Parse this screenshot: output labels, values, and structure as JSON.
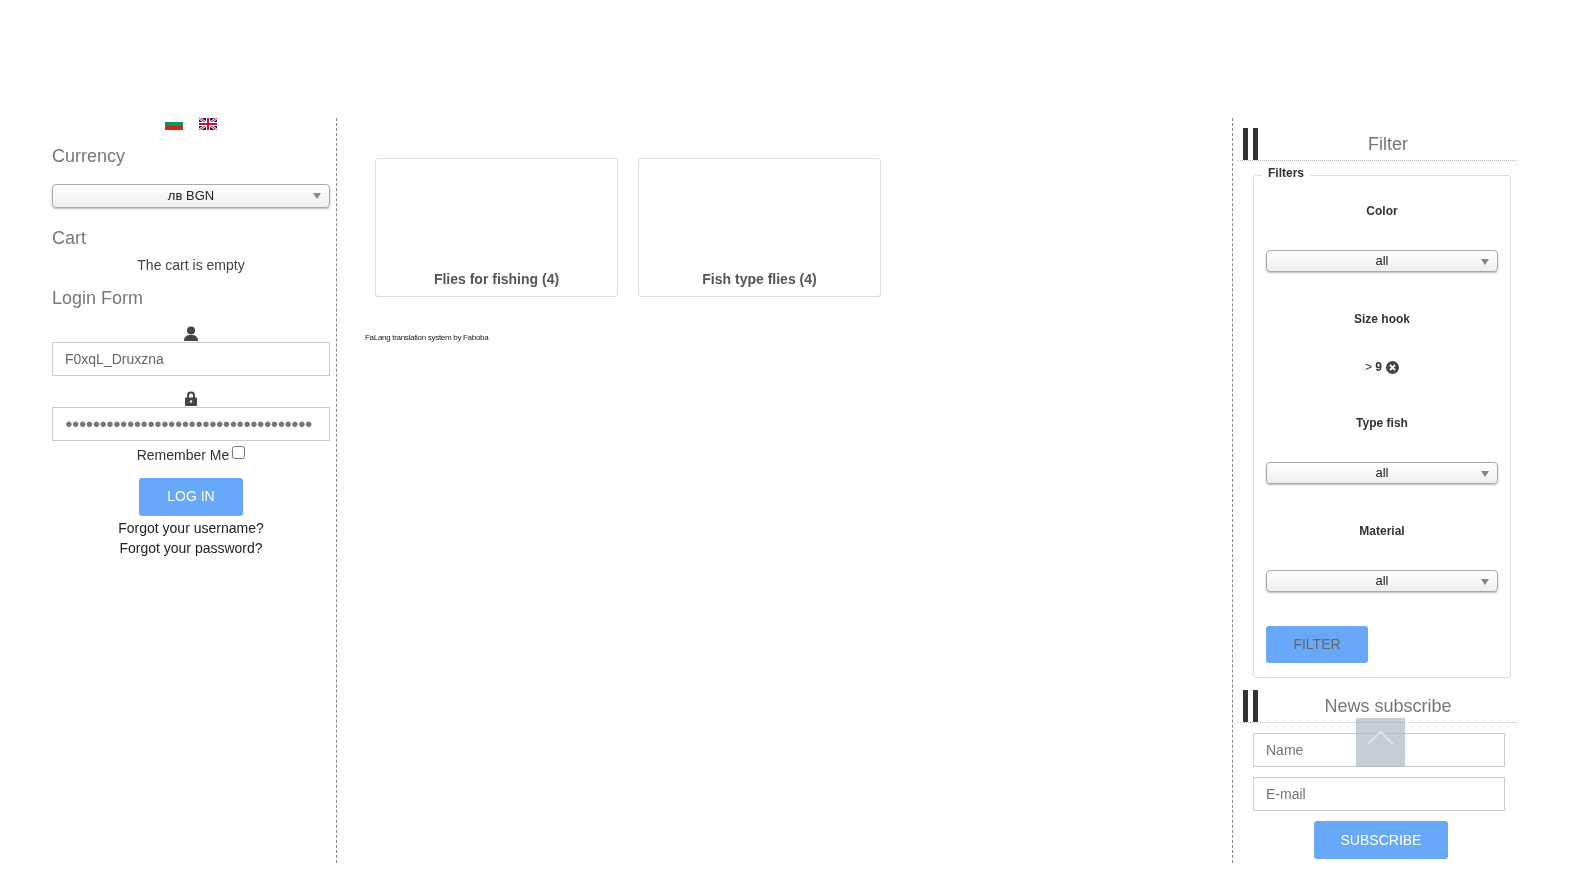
{
  "languages": [
    {
      "kind": "bg"
    },
    {
      "kind": "en"
    }
  ],
  "currency": {
    "title": "Currency",
    "value": "лв BGN"
  },
  "cart": {
    "title": "Cart",
    "message": "The cart is empty"
  },
  "login": {
    "title": "Login Form",
    "username": "F0xqL_Druxzna",
    "password": "●●●●●●●●●●●●●●●●●●●●●●●●●●●●●●●●●●●●",
    "remember_label": "Remember Me",
    "remember_checked": false,
    "button": "LOG IN",
    "links": [
      "Forgot your username?",
      "Forgot your password?"
    ]
  },
  "categories": [
    {
      "title": "Flies for fishing (4)"
    },
    {
      "title": "Fish type flies (4)"
    }
  ],
  "footer_credit": "FaLang translation system by Faboba",
  "filter": {
    "title": "Filter",
    "legend": "Filters",
    "fields": [
      {
        "kind": "select",
        "label": "Color",
        "value": "all"
      },
      {
        "kind": "chip",
        "label": "Size hook",
        "value": "> **9**"
      },
      {
        "kind": "select",
        "label": "Type fish",
        "value": "all"
      },
      {
        "kind": "select",
        "label": "Material",
        "value": "all"
      }
    ],
    "button": "FILTER"
  },
  "newsletter": {
    "title": "News subscribe",
    "fields": [
      {
        "placeholder": "Name"
      },
      {
        "placeholder": "E-mail"
      }
    ],
    "button": "SUBSCRIBE"
  }
}
